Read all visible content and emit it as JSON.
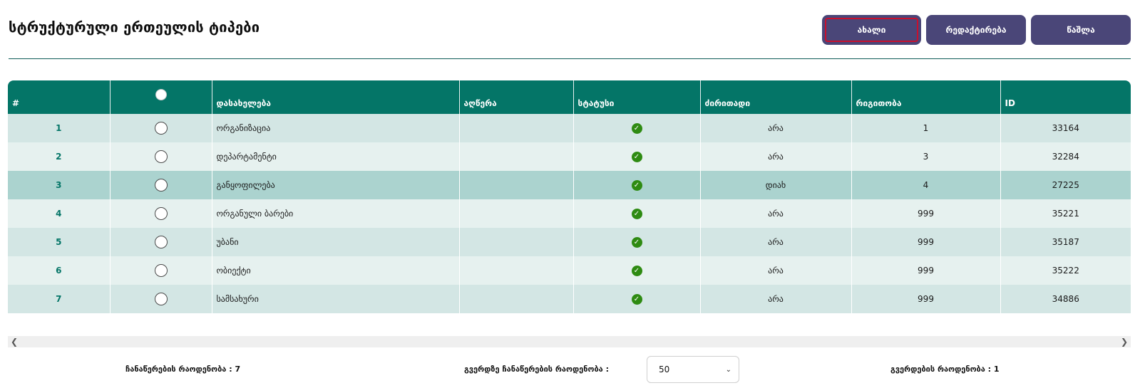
{
  "header": {
    "title": "სტრუქტურული ერთეულის ტიპები"
  },
  "toolbar": {
    "new_label": "ახალი",
    "edit_label": "რედაქტირება",
    "delete_label": "წაშლა"
  },
  "table": {
    "columns": [
      "#",
      "",
      "დასახელება",
      "აღწერა",
      "სტატუსი",
      "ძირითადი",
      "რიგითობა",
      "ID"
    ],
    "rows": [
      {
        "num": "1",
        "name": "ორგანიზაცია",
        "desc": "",
        "main": "არა",
        "order": "1",
        "id": "33164"
      },
      {
        "num": "2",
        "name": "დეპარტამენტი",
        "desc": "",
        "main": "არა",
        "order": "3",
        "id": "32284"
      },
      {
        "num": "3",
        "name": "განყოფილება",
        "desc": "",
        "main": "დიახ",
        "order": "4",
        "id": "27225"
      },
      {
        "num": "4",
        "name": "ორგანული ბარები",
        "desc": "",
        "main": "არა",
        "order": "999",
        "id": "35221"
      },
      {
        "num": "5",
        "name": "უბანი",
        "desc": "",
        "main": "არა",
        "order": "999",
        "id": "35187"
      },
      {
        "num": "6",
        "name": "ობიექტი",
        "desc": "",
        "main": "არა",
        "order": "999",
        "id": "35222"
      },
      {
        "num": "7",
        "name": "სამსახური",
        "desc": "",
        "main": "არა",
        "order": "999",
        "id": "34886"
      }
    ]
  },
  "footer": {
    "total_records": "ჩანაწერების რაოდენობა : 7",
    "per_page_label": "გვერდზე ჩანაწერების რაოდენობა :",
    "per_page_value": "50",
    "pages_count": "გვერდების რაოდენობა : 1"
  },
  "colors": {
    "header_bg": "#047567",
    "button_bg": "#4a4678",
    "status_ok": "#2e8b12"
  }
}
